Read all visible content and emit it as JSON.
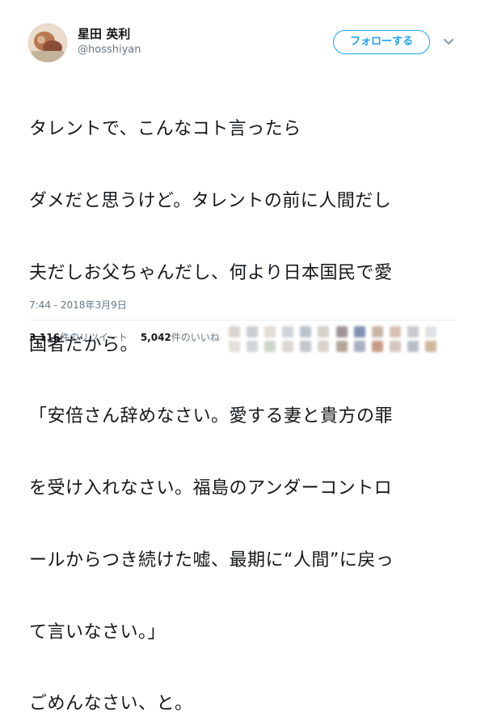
{
  "user": {
    "name": "星田 英利",
    "handle": "@hosshiyan"
  },
  "follow_button": {
    "label": "フォローする"
  },
  "tweet": {
    "lines": [
      "タレントで、こんなコト言ったら",
      "ダメだと思うけど。タレントの前に人間だし",
      "夫だしお父ちゃんだし、何より日本国民で愛",
      "国者だから。",
      "「安倍さん辞めなさい。愛する妻と貴方の罪",
      "を受け入れなさい。福島のアンダーコントロ",
      "ールからつき続けた嘘、最期に“人間”に戻っ",
      "て言いなさい。」",
      "ごめんなさい、と。"
    ],
    "timestamp": "7:44 - 2018年3月9日"
  },
  "stats": {
    "retweets_count": "3,116",
    "retweets_label": "件のリツイート",
    "likes_count": "5,042",
    "likes_label": "件のいいね"
  },
  "colors": {
    "accent": "#1da1f2",
    "secondary_text": "#657786",
    "divider": "#e6ecf0"
  }
}
